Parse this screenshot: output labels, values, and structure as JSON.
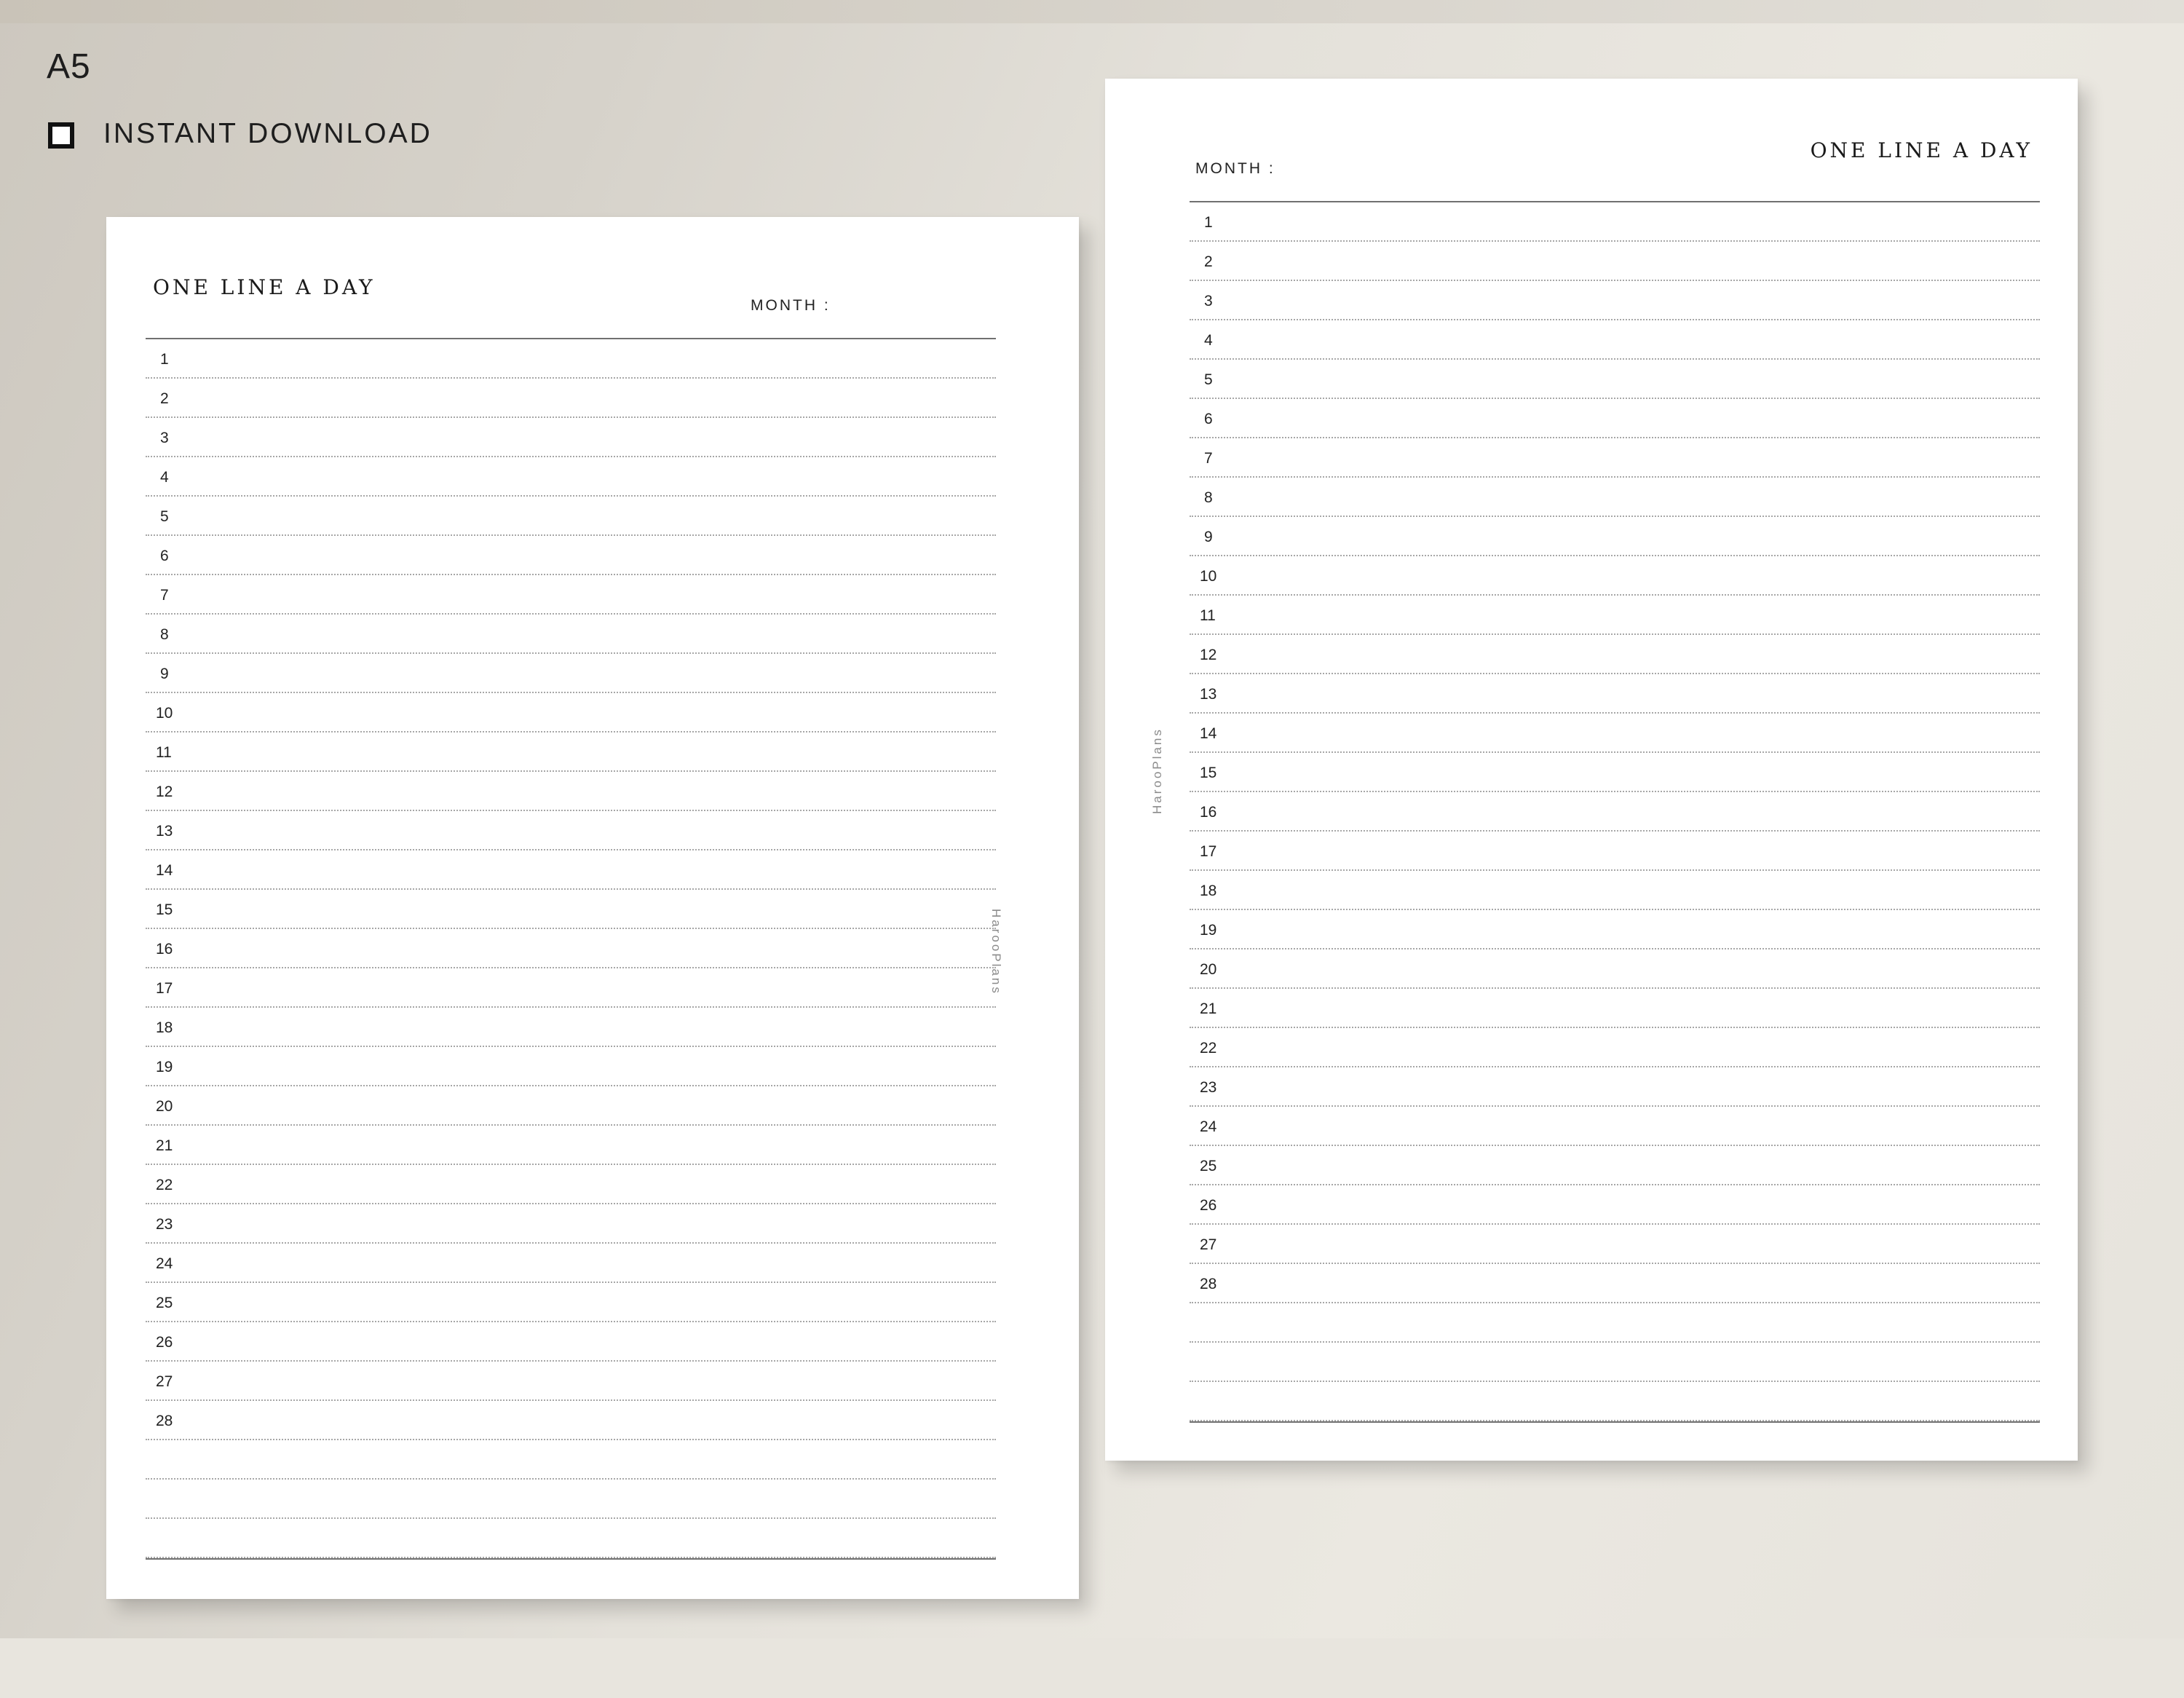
{
  "product": {
    "size_label": "A5",
    "download_label": "INSTANT DOWNLOAD",
    "checkbox_icon": "checkbox-square-icon"
  },
  "pages": [
    {
      "id": "page-left",
      "title": "ONE LINE A DAY",
      "month_label": "MONTH :",
      "watermark": "HarooPlans",
      "numbered_rows": 28,
      "blank_rows": 3
    },
    {
      "id": "page-right",
      "title": "ONE LINE A DAY",
      "month_label": "MONTH :",
      "watermark": "HarooPlans",
      "numbered_rows": 28,
      "blank_rows": 3
    }
  ],
  "days": [
    "1",
    "2",
    "3",
    "4",
    "5",
    "6",
    "7",
    "8",
    "9",
    "10",
    "11",
    "12",
    "13",
    "14",
    "15",
    "16",
    "17",
    "18",
    "19",
    "20",
    "21",
    "22",
    "23",
    "24",
    "25",
    "26",
    "27",
    "28"
  ],
  "colors": {
    "background": "#e8e5de",
    "page": "#ffffff",
    "text": "#1a1a1a",
    "dotted_line": "#a7a7a7",
    "solid_rule": "#707070"
  }
}
